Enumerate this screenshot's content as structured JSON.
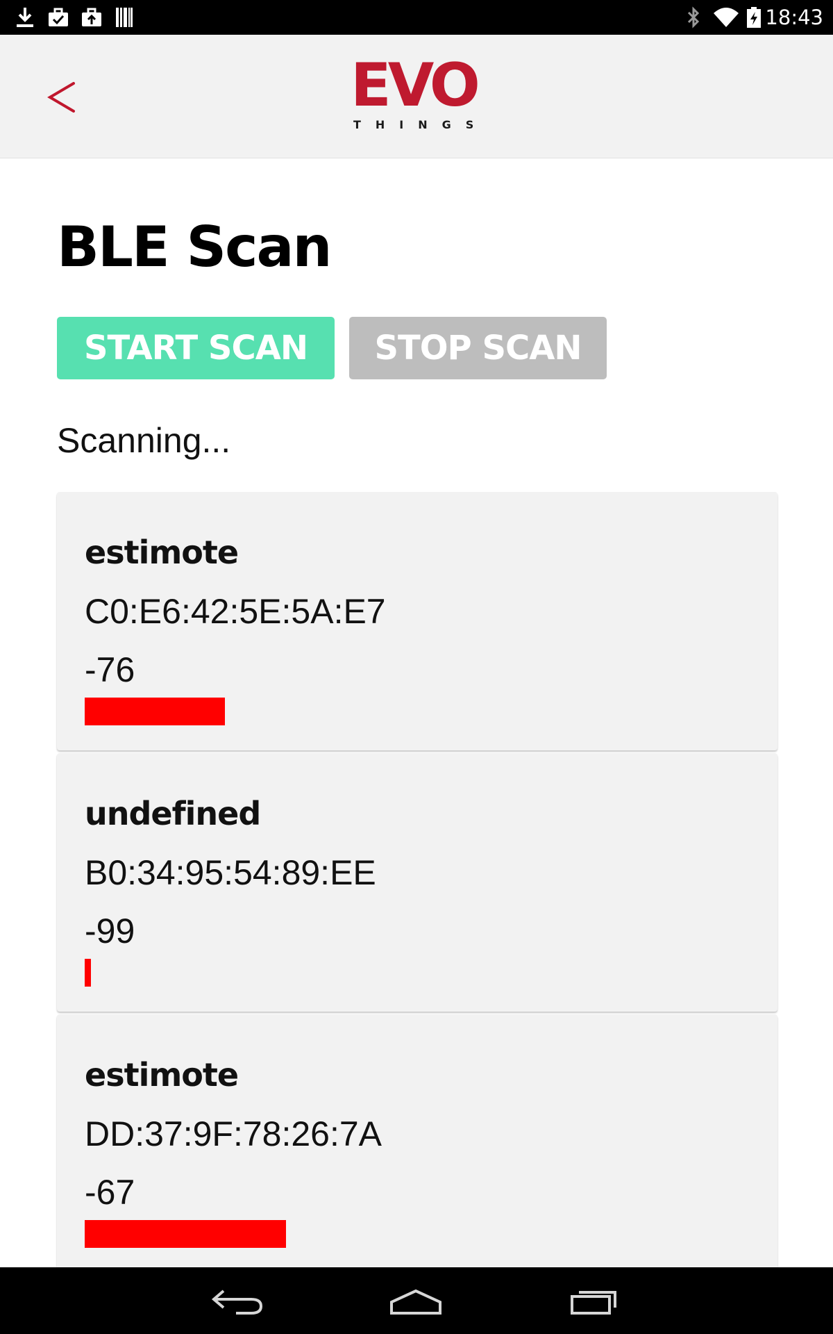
{
  "status_bar": {
    "time": "18:43",
    "left_icons": [
      "download-icon",
      "briefcase-check-icon",
      "briefcase-upload-icon",
      "barcode-icon"
    ],
    "right_icons": [
      "bluetooth-icon",
      "wifi-icon",
      "battery-charging-icon"
    ]
  },
  "header": {
    "back_icon": "chevron-left-icon",
    "logo": {
      "word": "EVO",
      "subtitle": "THINGS",
      "color": "#bf1a2f"
    }
  },
  "page": {
    "title": "BLE Scan",
    "start_label": "START SCAN",
    "stop_label": "STOP SCAN",
    "status": "Scanning..."
  },
  "devices": [
    {
      "name": "estimote",
      "address": "C0:E6:42:5E:5A:E7",
      "rssi": "-76",
      "signal_strength": 0.23
    },
    {
      "name": "undefined",
      "address": "B0:34:95:54:89:EE",
      "rssi": "-99",
      "signal_strength": 0.01
    },
    {
      "name": "estimote",
      "address": "DD:37:9F:78:26:7A",
      "rssi": "-67",
      "signal_strength": 0.33
    }
  ],
  "nav_bar": {
    "icons": [
      "back-icon",
      "home-icon",
      "recent-apps-icon"
    ]
  },
  "colors": {
    "start_button": "#57e0b0",
    "stop_button": "#bdbdbd",
    "signal_bar": "#ff0000",
    "accent": "#bf1a2f"
  }
}
